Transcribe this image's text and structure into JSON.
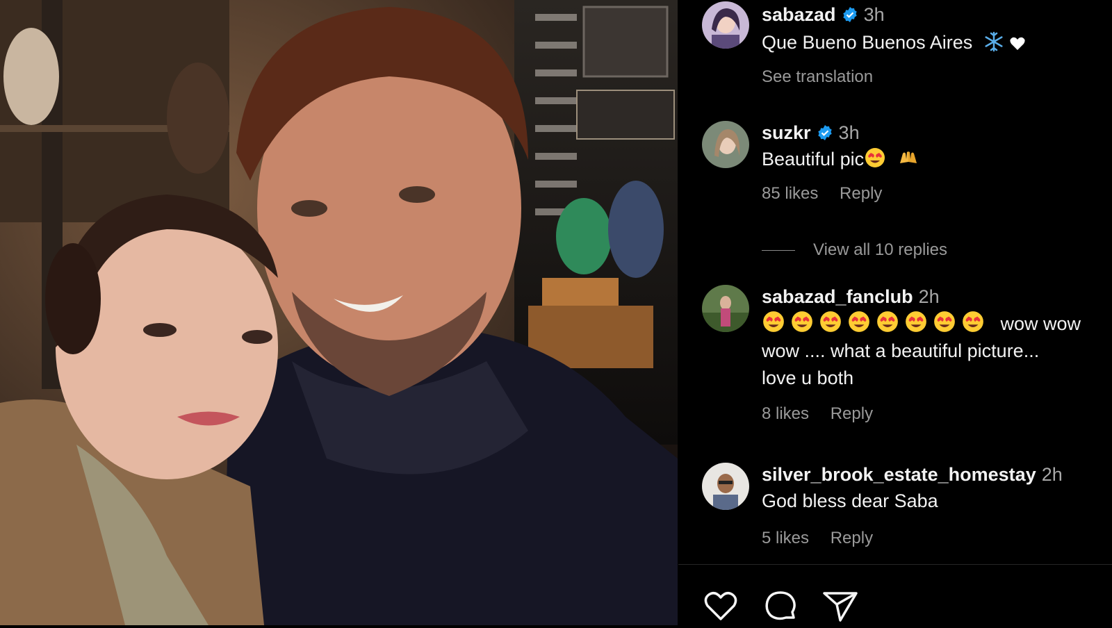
{
  "post": {
    "photo_alt": "Selfie of two people in a restaurant",
    "caption": {
      "username": "sabazad",
      "verified": true,
      "time": "3h",
      "text": "Que Bueno Buenos Aires",
      "emojis": [
        "snowflake",
        "white-heart"
      ],
      "see_translation": "See translation"
    }
  },
  "comments": [
    {
      "username": "suzkr",
      "verified": true,
      "time": "3h",
      "text": "Beautiful pic",
      "emojis": [
        "heart-eyes",
        "raised-hands"
      ],
      "likes": "85 likes",
      "reply": "Reply",
      "view_replies": "View all 10 replies"
    },
    {
      "username": "sabazad_fanclub",
      "verified": false,
      "time": "2h",
      "emoji_count": 8,
      "text_after_emojis": "wow wow",
      "text_line2": "wow .... what a beautiful picture...",
      "text_line3": "love u both",
      "likes": "8 likes",
      "reply": "Reply"
    },
    {
      "username": "silver_brook_estate_homestay",
      "verified": false,
      "time": "2h",
      "text": "God bless dear Saba",
      "likes": "5 likes",
      "reply": "Reply"
    }
  ],
  "actions": {
    "like_icon": "heart-outline-icon",
    "comment_icon": "comment-bubble-icon",
    "share_icon": "paper-plane-icon"
  },
  "colors": {
    "verified": "#1d9bf0",
    "muted_text": "#9a9a9a",
    "background": "#000000"
  }
}
